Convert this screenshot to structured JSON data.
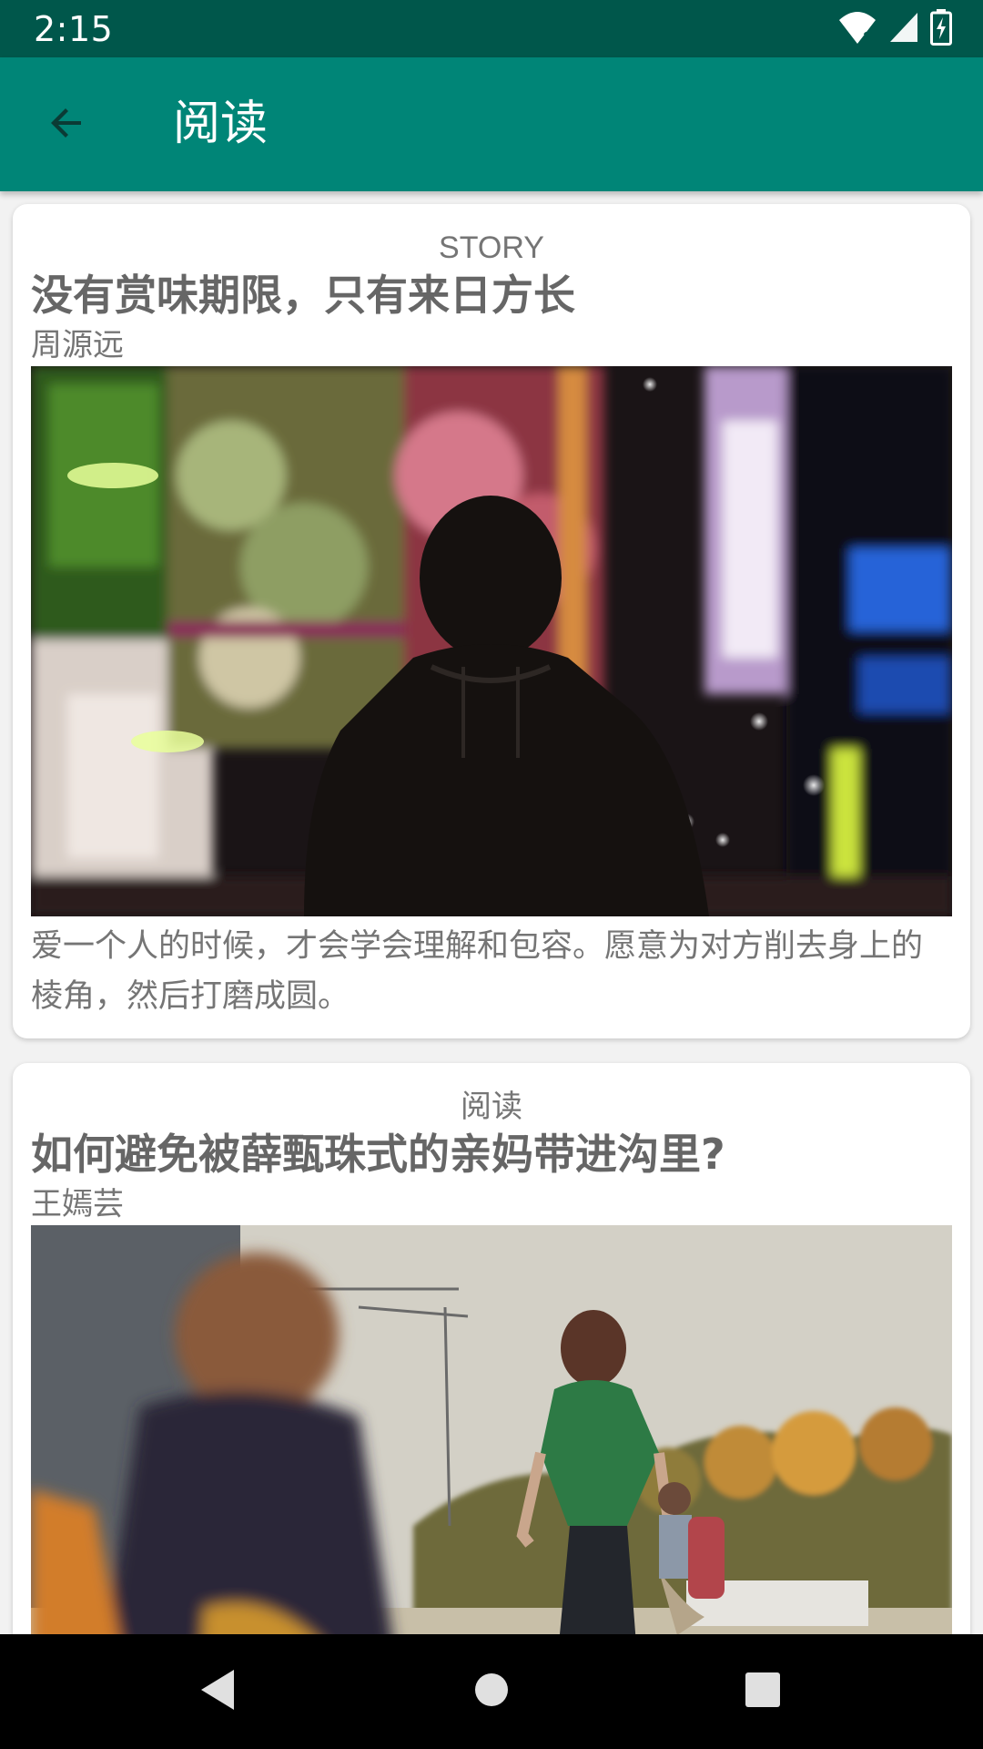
{
  "status_bar": {
    "time": "2:15",
    "icons": [
      "wifi-icon",
      "signal-icon",
      "battery-charging-icon"
    ]
  },
  "app_bar": {
    "title": "阅读",
    "back_icon": "arrow-back-icon"
  },
  "feed": {
    "cards": [
      {
        "category": "STORY",
        "title": "没有赏味期限，只有来日方长",
        "author": "周源远",
        "image_description": "silhouette-man-city-lights",
        "excerpt": "爱一个人的时候，才会学会理解和包容。愿意为对方削去身上的棱角，然后打磨成圆。"
      },
      {
        "category": "阅读",
        "title": "如何避免被薛甄珠式的亲妈带进沟里?",
        "author": "王嫣芸",
        "image_description": "woman-green-shirt-walking",
        "excerpt": ""
      }
    ]
  },
  "nav_bar": {
    "back_icon": "triangle-back-icon",
    "home_icon": "circle-home-icon",
    "recents_icon": "square-recents-icon"
  },
  "colors": {
    "primary": "#008577",
    "primary_dark": "#00574b",
    "accent": "#D81B60",
    "card_background": "#ffffff",
    "page_background": "#f2f2f2"
  }
}
